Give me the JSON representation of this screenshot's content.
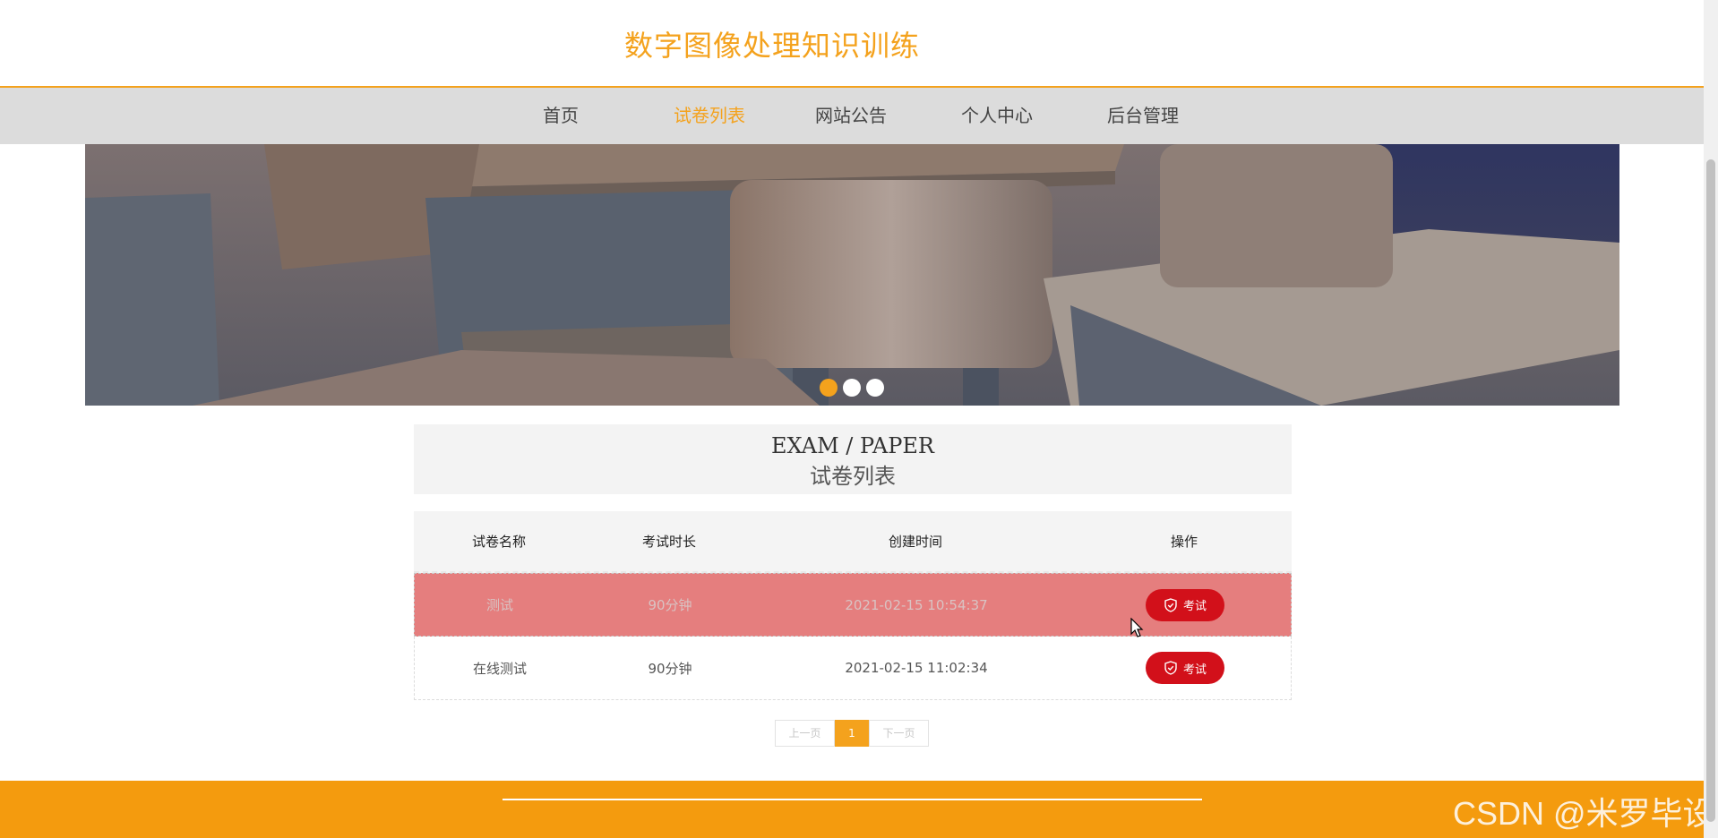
{
  "site": {
    "title": "数字图像处理知识训练"
  },
  "nav": {
    "items": [
      {
        "label": "首页"
      },
      {
        "label": "试卷列表"
      },
      {
        "label": "网站公告"
      },
      {
        "label": "个人中心"
      },
      {
        "label": "后台管理"
      }
    ],
    "active_index": 1
  },
  "banner": {
    "slides": 3,
    "active_slide": 0
  },
  "section": {
    "title_en": "EXAM / PAPER",
    "title_cn": "试卷列表"
  },
  "table": {
    "headers": [
      "试卷名称",
      "考试时长",
      "创建时间",
      "操作"
    ],
    "rows": [
      {
        "name": "测试",
        "duration": "90分钟",
        "created": "2021-02-15 10:54:37",
        "action": "考试"
      },
      {
        "name": "在线测试",
        "duration": "90分钟",
        "created": "2021-02-15 11:02:34",
        "action": "考试"
      }
    ]
  },
  "pagination": {
    "prev": "上一页",
    "current": "1",
    "next": "下一页"
  },
  "watermark": "CSDN @米罗毕设",
  "colors": {
    "accent": "#f4a21d",
    "button": "#d2101a",
    "row_hover": "#e57e7e",
    "footer": "#f49b0e"
  }
}
